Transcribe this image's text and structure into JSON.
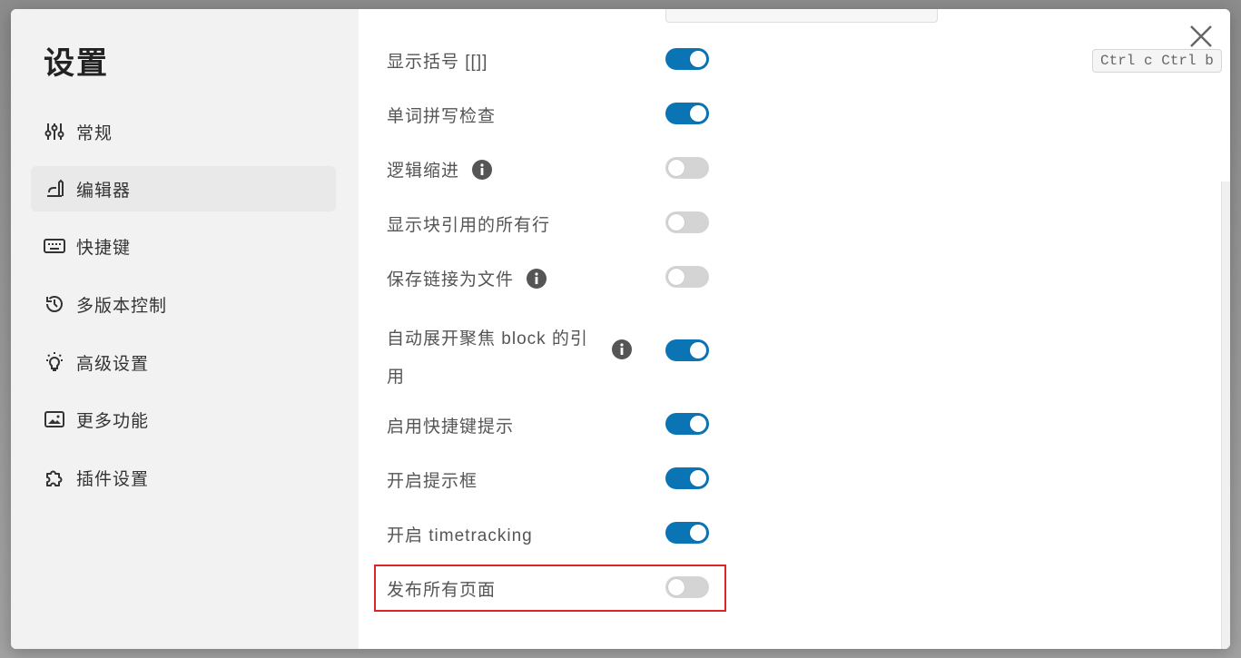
{
  "title": "设置",
  "close_icon": "close-icon",
  "shortcut_hint": "Ctrl c Ctrl b",
  "sidebar": {
    "items": [
      {
        "label": "常规",
        "icon": "sliders-icon"
      },
      {
        "label": "编辑器",
        "icon": "editor-icon",
        "active": true
      },
      {
        "label": "快捷键",
        "icon": "keyboard-icon"
      },
      {
        "label": "多版本控制",
        "icon": "history-icon"
      },
      {
        "label": "高级设置",
        "icon": "bulb-icon"
      },
      {
        "label": "更多功能",
        "icon": "picture-icon"
      },
      {
        "label": "插件设置",
        "icon": "puzzle-icon"
      }
    ]
  },
  "settings": [
    {
      "label": "显示括号 [[]]",
      "on": true
    },
    {
      "label": "单词拼写检查",
      "on": true
    },
    {
      "label": "逻辑缩进",
      "on": false,
      "info": true
    },
    {
      "label": "显示块引用的所有行",
      "on": false
    },
    {
      "label": "保存链接为文件",
      "on": false,
      "info": true
    },
    {
      "label": "自动展开聚焦 block 的引",
      "label_line2": "用",
      "on": true,
      "info": true
    },
    {
      "label": "启用快捷键提示",
      "on": true
    },
    {
      "label": "开启提示框",
      "on": true
    },
    {
      "label": "开启 timetracking",
      "on": true
    },
    {
      "label": "发布所有页面",
      "on": false,
      "highlighted": true
    }
  ],
  "colors": {
    "toggle_on": "#0b74b4",
    "toggle_off": "#d4d4d4",
    "highlight": "#d9262b"
  }
}
